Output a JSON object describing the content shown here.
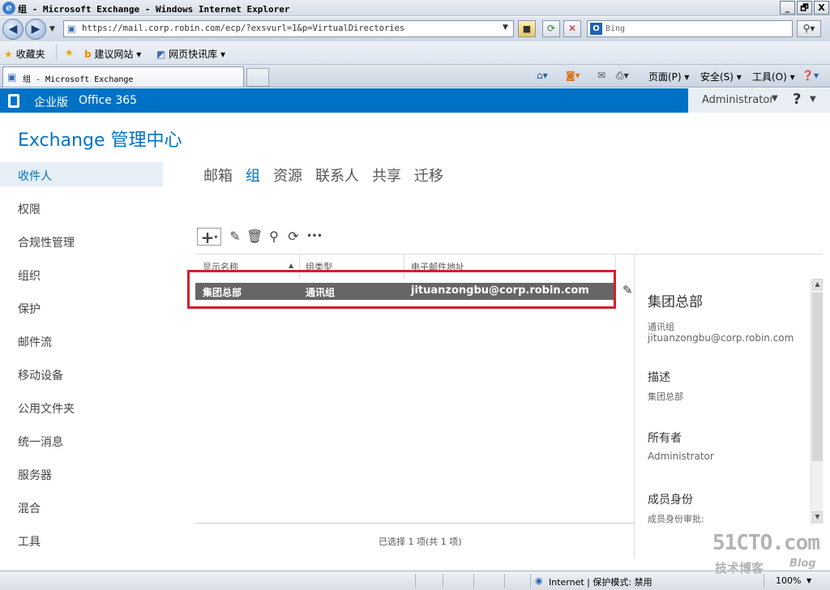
{
  "browser": {
    "window_title": "组 - Microsoft Exchange - Windows Internet Explorer",
    "window_controls": [
      "_",
      "🗗",
      "X"
    ],
    "url": "https://mail.corp.robin.com/ecp/?exsvurl=1&p=VirtualDirectories",
    "search_placeholder": "Bing",
    "favorites_label": "收藏夹",
    "favorites": [
      "建议网站 ▾",
      "网页快讯库 ▾"
    ],
    "tab_title": "组 - Microsoft Exchange",
    "command_bar": [
      "页面(P) ▾",
      "安全(S) ▾",
      "工具(O) ▾"
    ],
    "status_zone": "Internet | 保护模式: 禁用",
    "zoom": "100%"
  },
  "header": {
    "edition": "企业版",
    "product": "Office 365",
    "user": "Administrator",
    "help": "?"
  },
  "page_title": "Exchange 管理中心",
  "left_nav": [
    "收件人",
    "权限",
    "合规性管理",
    "组织",
    "保护",
    "邮件流",
    "移动设备",
    "公用文件夹",
    "统一消息",
    "服务器",
    "混合",
    "工具"
  ],
  "tabs": [
    "邮箱",
    "组",
    "资源",
    "联系人",
    "共享",
    "迁移"
  ],
  "toolbar": {
    "add": "+",
    "more": "•••"
  },
  "grid": {
    "columns": [
      "显示名称",
      "组类型",
      "电子邮件地址"
    ],
    "rows": [
      {
        "name": "集团总部",
        "type": "通讯组",
        "email": "jituanzongbu@corp.robin.com"
      }
    ],
    "status": "已选择 1 项(共 1 项)"
  },
  "details": {
    "title": "集团总部",
    "type": "通讯组",
    "email": "jituanzongbu@corp.robin.com",
    "desc_label": "描述",
    "desc_value": "集团总部",
    "owner_label": "所有者",
    "owner_value": "Administrator",
    "membership_label": "成员身份",
    "membership_sub": "成员身份审批:"
  },
  "watermark": {
    "site": "51CTO.com",
    "line2": "技术博客",
    "blog": "Blog"
  }
}
